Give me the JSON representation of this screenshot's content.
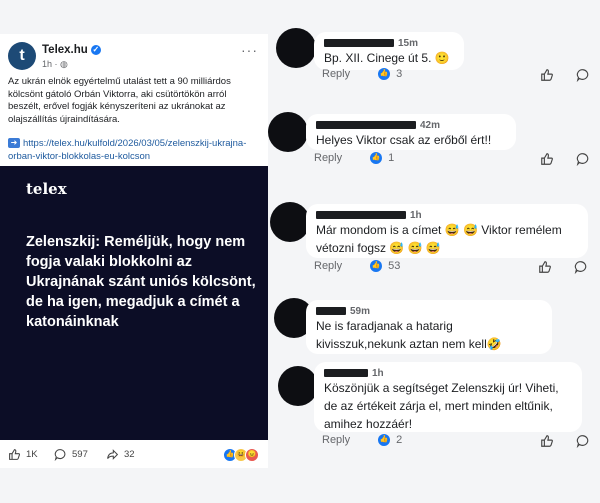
{
  "post": {
    "page_name": "Telex.hu",
    "time": "1h · ",
    "more": "···",
    "text": "Az ukrán elnök egyértelmű utalást tett a 90 milliárdos kölcsönt gátoló Orbán Viktorra, aki csütörtökön arról beszélt, erővel fogják kényszeríteni az ukránokat az olajszállítás újraindítására.",
    "link": "https://telex.hu/kulfold/2026/03/05/zelenszkij-ukrajna-orban-viktor-blokkolas-eu-kolcson",
    "hero_logo": "telex",
    "hero_text": "Zelenszkij: Reméljük, hogy nem fogja valaki blokkolni az Ukrajnának szánt uniós kölcsönt, de ha igen, megadjuk a címét a katonáinknak",
    "likes": "1K",
    "comments": "597",
    "shares": "32"
  },
  "comments": [
    {
      "time": "15m",
      "text": "Bp. XII. Cinege út 5. 🙂",
      "reply": "Reply",
      "likes": "3"
    },
    {
      "time": "42m",
      "text": "Helyes Viktor csak az erőből ért!!",
      "reply": "Reply",
      "likes": "1"
    },
    {
      "time": "1h",
      "text": "Már mondom is a címet 😅 😅  Viktor remélem vétozni fogsz 😅 😅 😅",
      "reply": "Reply",
      "likes": "53"
    },
    {
      "time": "59m",
      "text": "Ne is faradjanak a hatarig kivisszuk,nekunk aztan nem kell🤣",
      "reply": "",
      "likes": ""
    },
    {
      "time": "1h",
      "text": "Köszönjük a segítséget Zelenszkij úr! Viheti, de az értékeit zárja el, mert minden eltűnik, amihez hozzáér!",
      "reply": "Reply",
      "likes": "2"
    }
  ]
}
